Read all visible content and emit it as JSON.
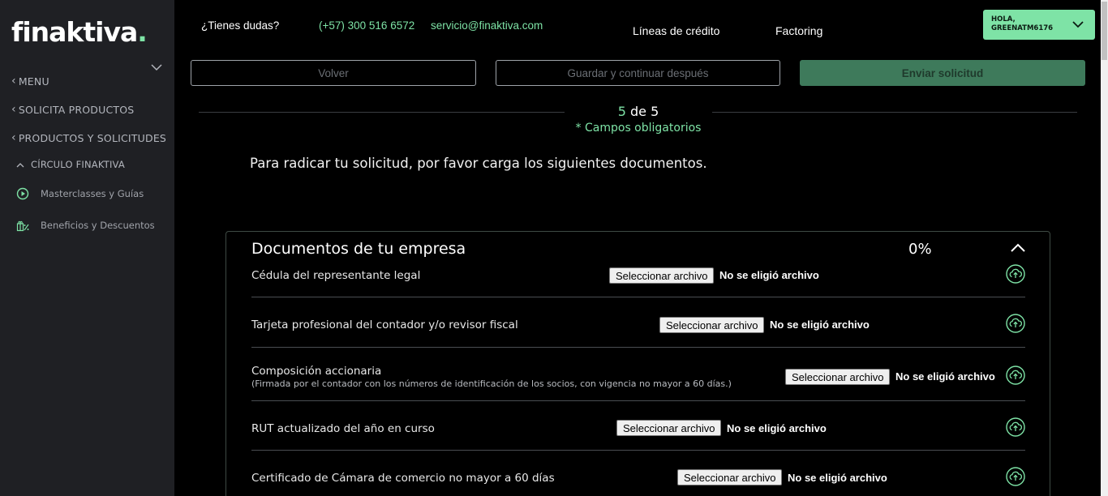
{
  "brand": {
    "logo_text": "finaktiva",
    "logo_dot": ".",
    "accent": "#7ee3a6"
  },
  "sidebar": {
    "items": [
      {
        "label": "MENU"
      },
      {
        "label": "SOLICITA PRODUCTOS"
      },
      {
        "label": "PRODUCTOS Y SOLICITUDES"
      }
    ],
    "group": {
      "label": "CÍRCULO FINAKTIVA"
    },
    "sub_items": [
      {
        "label": "Masterclasses y Guías",
        "icon": "play-circle-icon"
      },
      {
        "label": "Beneficios y Descuentos",
        "icon": "gift-percent-icon"
      }
    ]
  },
  "header": {
    "questions": "¿Tienes dudas?",
    "phone": "(+57) 300 516 6572",
    "email": "servicio@finaktiva.com",
    "nav": [
      "Líneas de crédito",
      "Factoring"
    ],
    "user_greeting": "HOLA,",
    "user_name": "GREENATM6176"
  },
  "actions": {
    "back": "Volver",
    "save_later": "Guardar y continuar después",
    "submit": "Enviar solicitud"
  },
  "step": {
    "current": "5",
    "of_label": "de 5",
    "required_note": "* Campos obligatorios"
  },
  "intro": "Para radicar tu solicitud, por favor carga los siguientes documentos.",
  "documents_section": {
    "title": "Documentos de tu empresa",
    "progress": "0%",
    "file_button": "Seleccionar archivo",
    "no_file": "No se eligió archivo",
    "items": [
      {
        "label": "Cédula del representante legal",
        "note": ""
      },
      {
        "label": "Tarjeta profesional del contador y/o revisor fiscal",
        "note": ""
      },
      {
        "label": "Composición accionaria",
        "note": "(Firmada por el contador con los números de identificación de los socios, con vigencia no mayor a 60 días.)"
      },
      {
        "label": "RUT actualizado del año en curso",
        "note": ""
      },
      {
        "label": "Certificado de Cámara de comercio no mayor a 60 días",
        "note": ""
      }
    ]
  }
}
